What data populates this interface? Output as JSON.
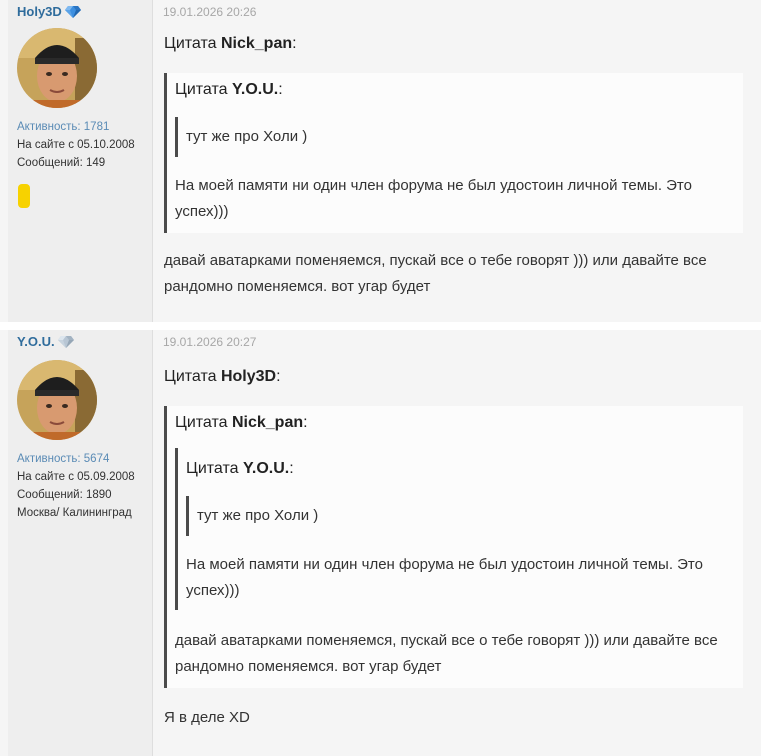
{
  "posts": [
    {
      "author": {
        "name": "Holy3D",
        "activity": "Активность: 1781",
        "joined": "На сайте с 05.10.2008",
        "messages": "Сообщений: 149",
        "gem_color": "#3d8fe0"
      },
      "date": "19.01.2026 20:26",
      "quote_header_prefix": "Цитата",
      "quote_author": "Nick_pan",
      "nested_quote": {
        "prefix": "Цитата",
        "author": "Y.O.U.",
        "inner_text": "тут же про Холи )",
        "text": "На моей памяти ни один член форума не был удостоин личной темы. Это успех)))"
      },
      "reply": "давай аватарками поменяемся, пускай все о тебе говорят ))) или давайте все рандомно поменяемся. вот угар будет"
    },
    {
      "author": {
        "name": "Y.O.U.",
        "activity": "Активность: 5674",
        "joined": "На сайте с 05.09.2008",
        "messages": "Сообщений: 1890",
        "location": "Москва/ Калининград",
        "gem_color": "#b8c6d4"
      },
      "date": "19.01.2026 20:27",
      "quote_header_prefix": "Цитата",
      "quote_author": "Holy3D",
      "nested_quote": {
        "prefix": "Цитата",
        "author": "Nick_pan",
        "deep_quote": {
          "prefix": "Цитата",
          "author": "Y.O.U.",
          "inner_text": "тут же про Холи )",
          "text": "На моей памяти ни один член форума не был удостоин личной темы. Это успех)))"
        },
        "text": "давай аватарками поменяемся, пускай все о тебе говорят ))) или давайте все рандомно поменяемся. вот угар будет"
      },
      "reply": "Я в деле XD"
    }
  ]
}
